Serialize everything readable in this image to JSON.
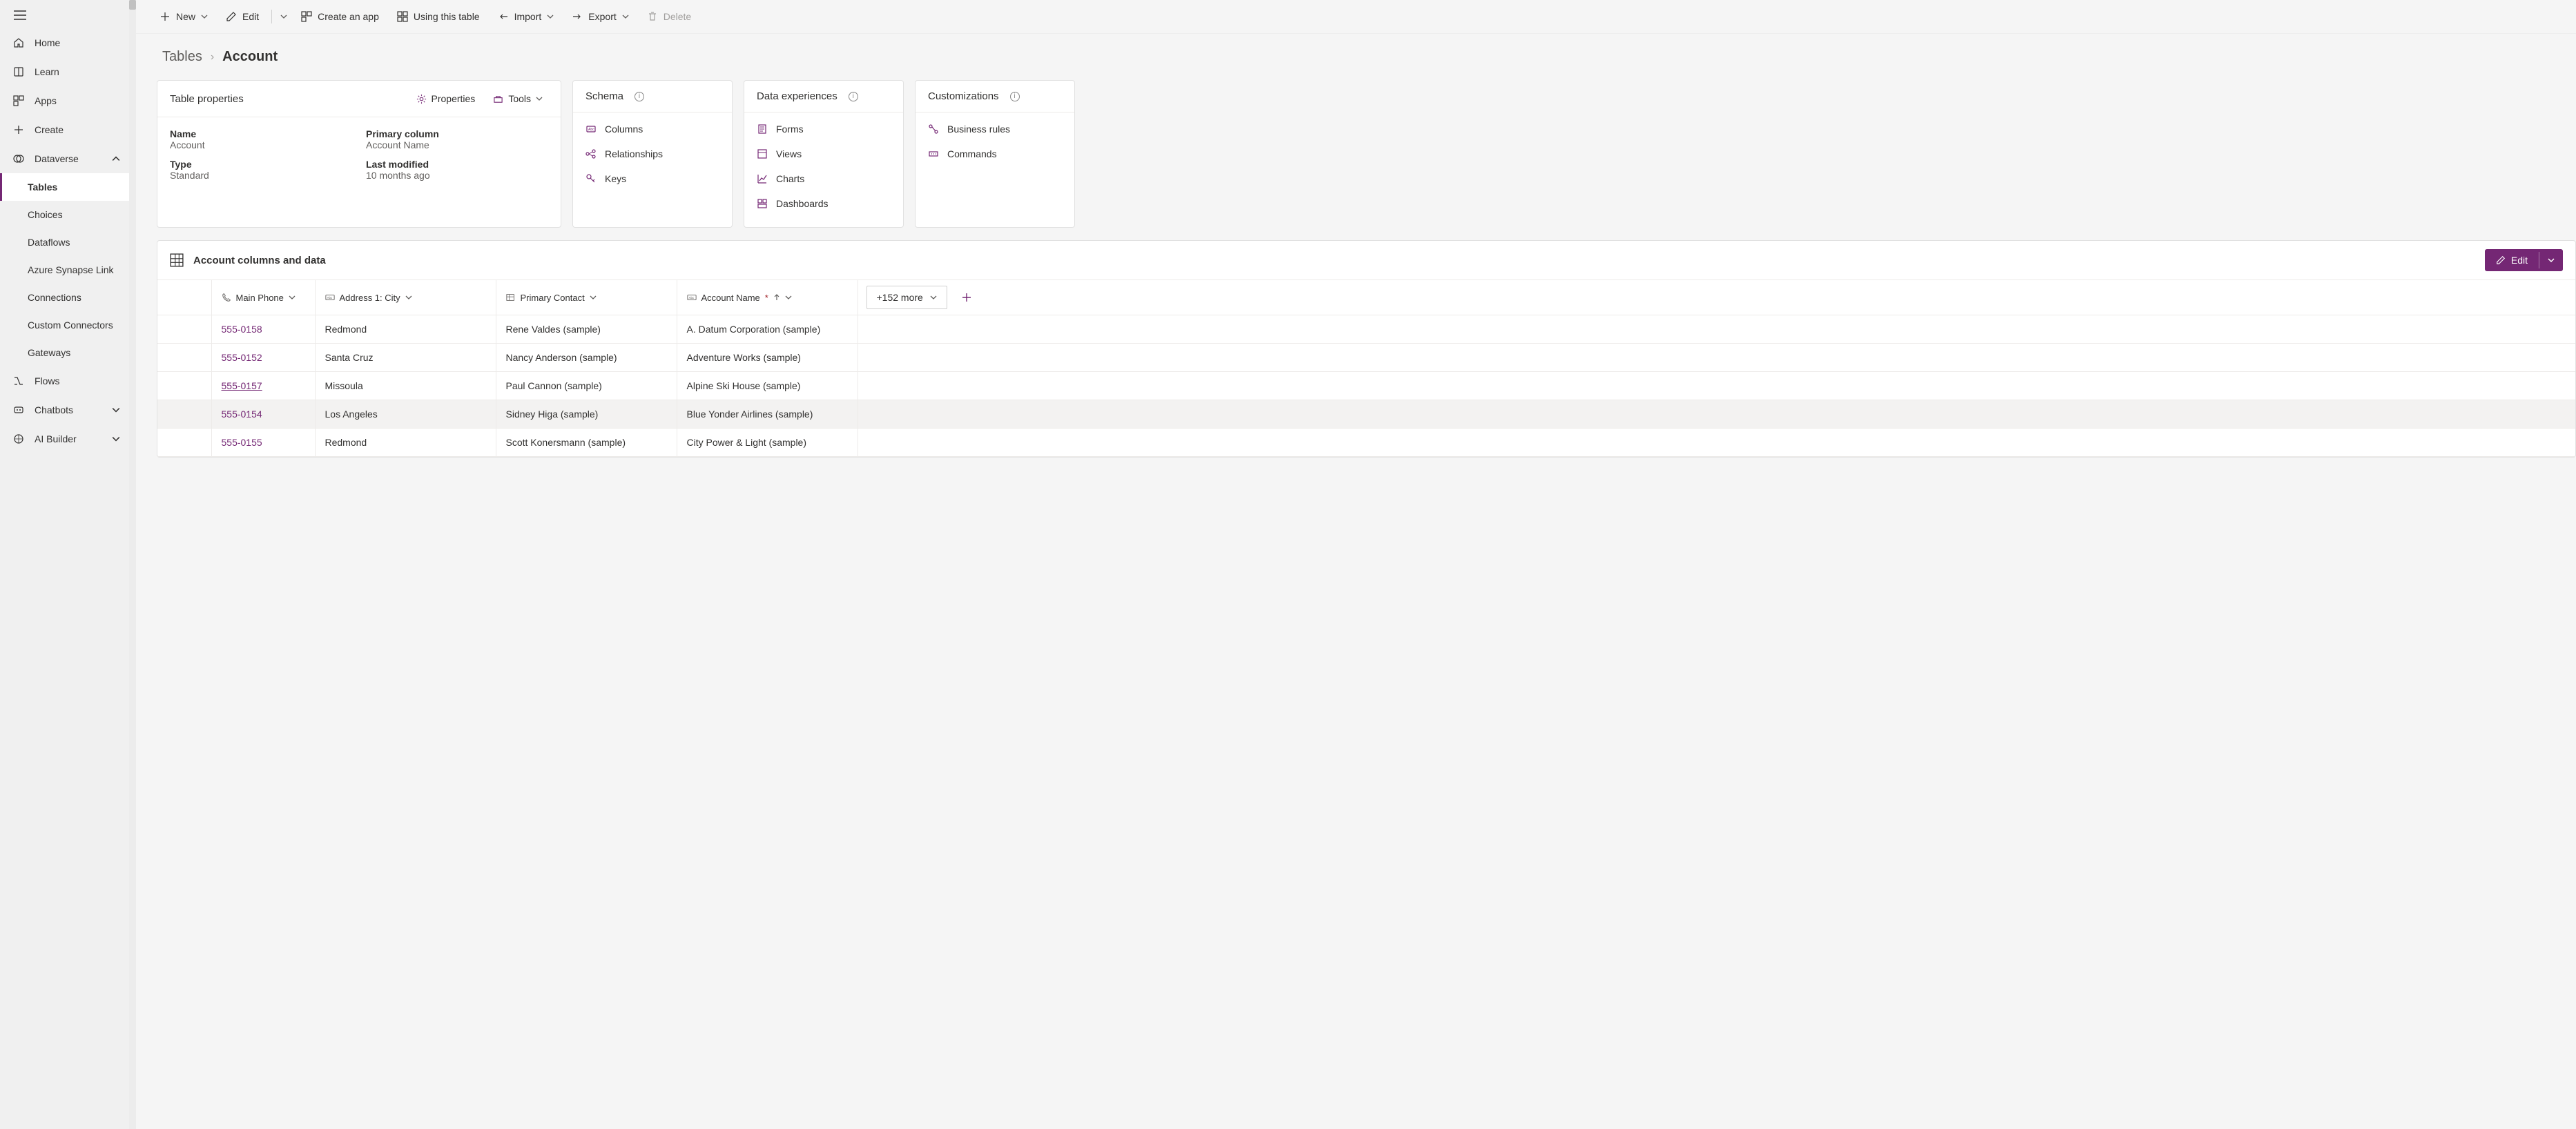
{
  "sidebar": {
    "items": [
      {
        "label": "Home"
      },
      {
        "label": "Learn"
      },
      {
        "label": "Apps"
      },
      {
        "label": "Create"
      },
      {
        "label": "Dataverse",
        "expanded": true,
        "sub": [
          {
            "label": "Tables",
            "active": true
          },
          {
            "label": "Choices"
          },
          {
            "label": "Dataflows"
          },
          {
            "label": "Azure Synapse Link"
          },
          {
            "label": "Connections"
          },
          {
            "label": "Custom Connectors"
          },
          {
            "label": "Gateways"
          }
        ]
      },
      {
        "label": "Flows"
      },
      {
        "label": "Chatbots",
        "expandable": true
      },
      {
        "label": "AI Builder",
        "expandable": true
      }
    ]
  },
  "commandbar": {
    "new": "New",
    "edit": "Edit",
    "create_app": "Create an app",
    "using_table": "Using this table",
    "import": "Import",
    "export": "Export",
    "delete": "Delete"
  },
  "breadcrumbs": {
    "parent": "Tables",
    "current": "Account"
  },
  "cards": {
    "properties": {
      "title": "Table properties",
      "properties_btn": "Properties",
      "tools_btn": "Tools",
      "name_label": "Name",
      "name_value": "Account",
      "type_label": "Type",
      "type_value": "Standard",
      "primary_label": "Primary column",
      "primary_value": "Account Name",
      "modified_label": "Last modified",
      "modified_value": "10 months ago"
    },
    "schema": {
      "title": "Schema",
      "links": [
        "Columns",
        "Relationships",
        "Keys"
      ]
    },
    "data_exp": {
      "title": "Data experiences",
      "links": [
        "Forms",
        "Views",
        "Charts",
        "Dashboards"
      ]
    },
    "custom": {
      "title": "Customizations",
      "links": [
        "Business rules",
        "Commands"
      ]
    }
  },
  "data_section": {
    "title": "Account columns and data",
    "edit": "Edit",
    "more": "+152 more",
    "columns": [
      {
        "label": "Main Phone",
        "type": "phone"
      },
      {
        "label": "Address 1: City",
        "type": "text"
      },
      {
        "label": "Primary Contact",
        "type": "lookup"
      },
      {
        "label": "Account Name",
        "type": "text",
        "required": true,
        "sort": "asc"
      }
    ],
    "rows": [
      {
        "phone": "555-0158",
        "city": "Redmond",
        "contact": "Rene Valdes (sample)",
        "account": "A. Datum Corporation (sample)"
      },
      {
        "phone": "555-0152",
        "city": "Santa Cruz",
        "contact": "Nancy Anderson (sample)",
        "account": "Adventure Works (sample)"
      },
      {
        "phone": "555-0157",
        "city": "Missoula",
        "contact": "Paul Cannon (sample)",
        "account": "Alpine Ski House (sample)",
        "underline": true
      },
      {
        "phone": "555-0154",
        "city": "Los Angeles",
        "contact": "Sidney Higa (sample)",
        "account": "Blue Yonder Airlines (sample)",
        "hover": true
      },
      {
        "phone": "555-0155",
        "city": "Redmond",
        "contact": "Scott Konersmann (sample)",
        "account": "City Power & Light (sample)"
      }
    ]
  }
}
